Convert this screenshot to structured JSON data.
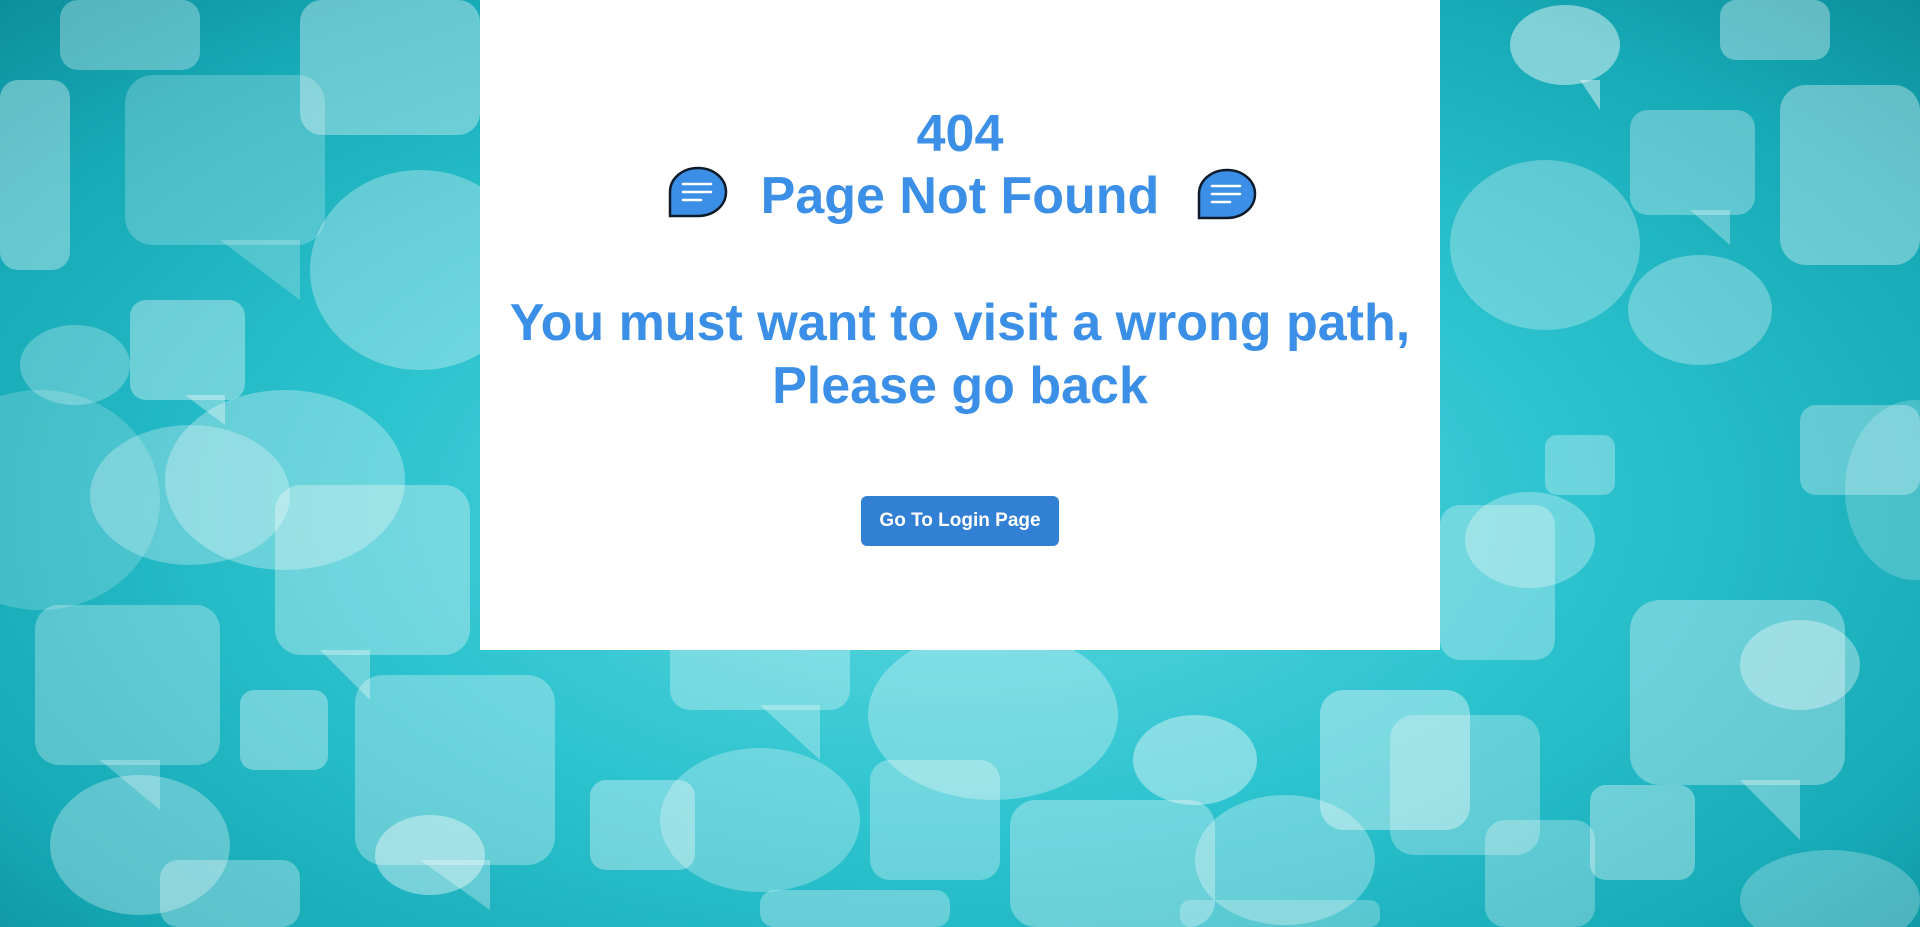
{
  "error": {
    "code": "404",
    "title": "Page Not Found",
    "message_line1": "You must want to visit a wrong path,",
    "message_line2": "Please go back"
  },
  "actions": {
    "login_button_label": "Go To Login Page"
  },
  "icons": {
    "title_decoration": "chat-bubble-icon"
  },
  "colors": {
    "heading_text": "#3b8fe6",
    "button_bg": "#3280d4",
    "button_text": "#ffffff",
    "icon_fill": "#3b8fe6",
    "panel_bg": "#ffffff",
    "background": "#2cc3cf"
  }
}
